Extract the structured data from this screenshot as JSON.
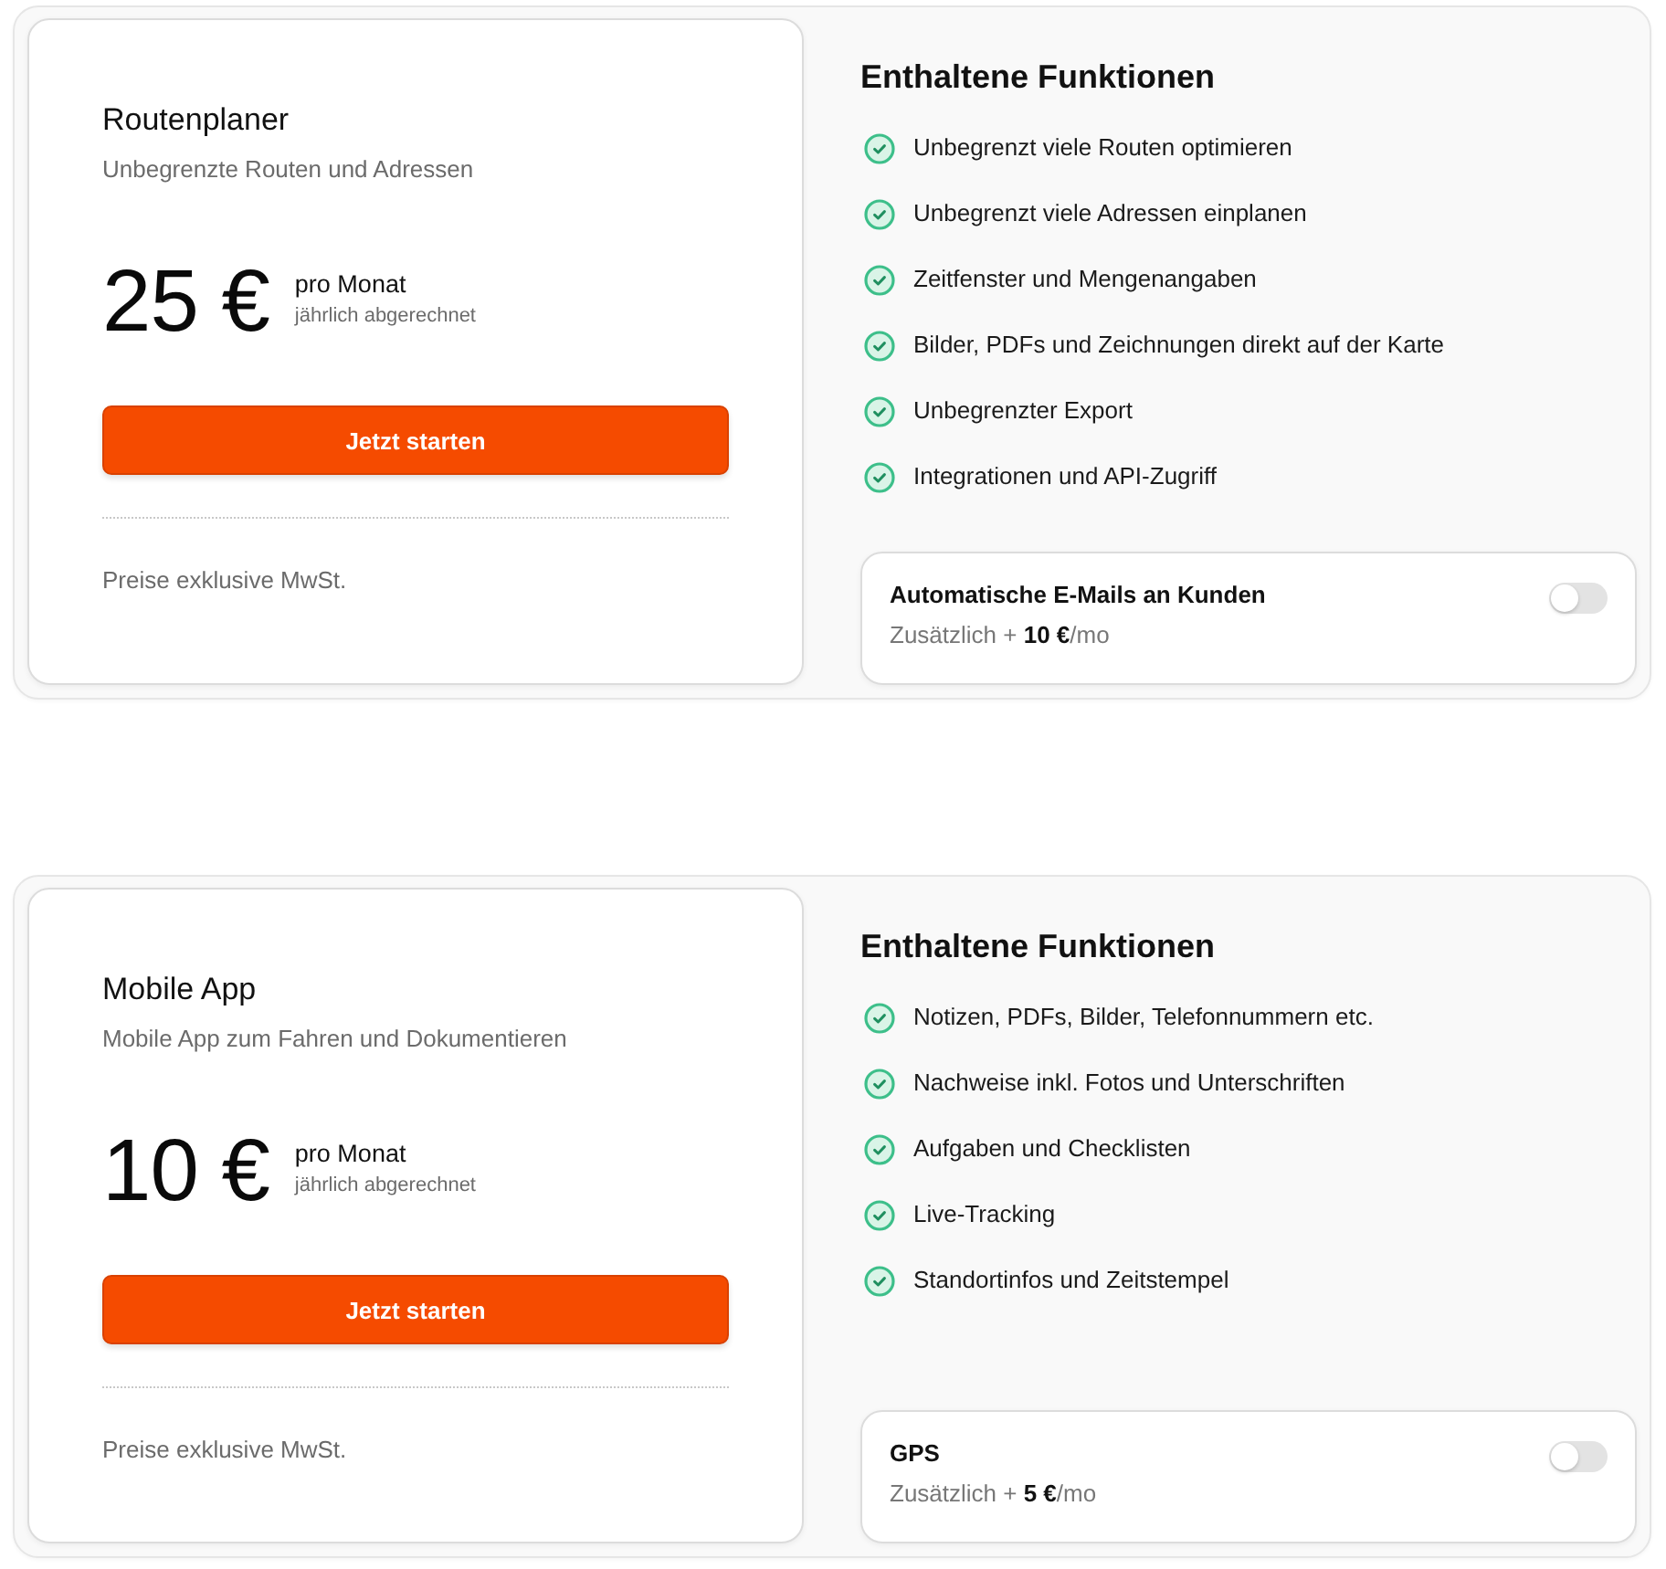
{
  "plans": [
    {
      "name": "Routenplaner",
      "description": "Unbegrenzte Routen und Adressen",
      "price": "25 €",
      "period": "pro Monat",
      "billing": "jährlich abgerechnet",
      "cta": "Jetzt starten",
      "note": "Preise exklusive MwSt.",
      "features_title": "Enthaltene Funktionen",
      "features": [
        "Unbegrenzt viele Routen optimieren",
        "Unbegrenzt viele Adressen einplanen",
        "Zeitfenster und Mengenangaben",
        "Bilder, PDFs und Zeichnungen direkt auf der Karte",
        "Unbegrenzter Export",
        "Integrationen und API-Zugriff"
      ],
      "addon": {
        "title": "Automatische E-Mails an Kunden",
        "price": "Zusätzlich + **10 €**/mo",
        "on": false
      }
    },
    {
      "name": "Mobile App",
      "description": "Mobile App zum Fahren und Dokumentieren",
      "price": "10 €",
      "period": "pro Monat",
      "billing": "jährlich abgerechnet",
      "cta": "Jetzt starten",
      "note": "Preise exklusive MwSt.",
      "features_title": "Enthaltene Funktionen",
      "features": [
        "Notizen, PDFs, Bilder, Telefonnummern etc.",
        "Nachweise inkl. Fotos und Unterschriften",
        "Aufgaben und Checklisten",
        "Live-Tracking",
        "Standortinfos und Zeitstempel"
      ],
      "addon": {
        "title": "GPS",
        "price": "Zusätzlich + **5 €**/mo",
        "on": false
      }
    }
  ]
}
